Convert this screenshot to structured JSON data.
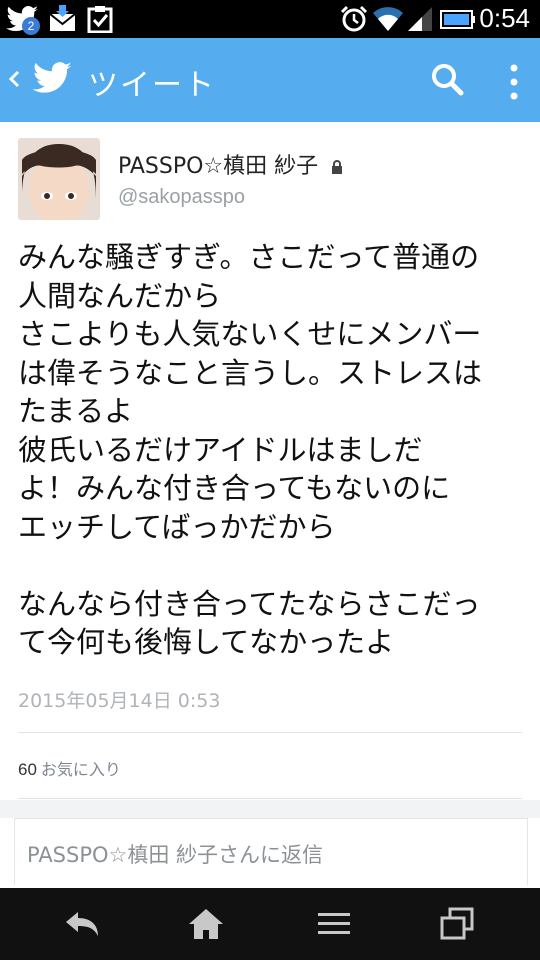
{
  "status_bar": {
    "time": "0:54",
    "notification_count": "2",
    "icons": [
      "twitter-icon",
      "mail-download-icon",
      "clipboard-check-icon",
      "alarm-icon",
      "wifi-icon",
      "signal-icon",
      "battery-icon"
    ]
  },
  "action_bar": {
    "title": "ツイート",
    "color": "#55acee",
    "icons": [
      "back-chevron-icon",
      "twitter-bird-icon",
      "search-icon",
      "overflow-menu-icon"
    ]
  },
  "tweet": {
    "display_name": "PASSPO☆槙田 紗子",
    "handle": "@sakopasspo",
    "protected": true,
    "text_lines": [
      "みんな騒ぎすぎ。さこだって普通の",
      "人間なんだから",
      "さこよりも人気ないくせにメンバー",
      "は偉そうなこと言うし。ストレスは",
      "たまるよ",
      "彼氏いるだけアイドルはましだ",
      "よ！みんな付き合ってもないのに",
      "エッチしてばっかだから",
      "",
      "なんなら付き合ってたならさこだっ",
      "て今何も後悔してなかったよ"
    ],
    "timestamp": "2015年05月14日 0:53",
    "favorites_count": "60",
    "favorites_label": "お気に入り"
  },
  "reply": {
    "placeholder": "PASSPO☆槙田 紗子さんに返信"
  },
  "nav_bar": {
    "icons": [
      "back-arrow-icon",
      "home-icon",
      "menu-icon",
      "recent-apps-icon"
    ]
  }
}
